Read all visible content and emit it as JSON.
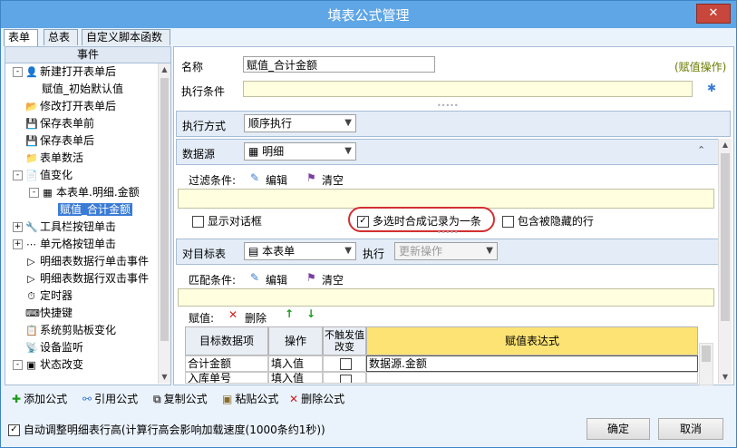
{
  "window": {
    "title": "填表公式管理",
    "close": "✕"
  },
  "tabs": [
    "表单",
    "总表",
    "自定义脚本函数"
  ],
  "left": {
    "header": "事件",
    "tree": [
      {
        "label": "新建打开表单后",
        "indent": 0,
        "exp": "-",
        "icon": "👤"
      },
      {
        "label": "赋值_初始默认值",
        "indent": 1,
        "exp": "",
        "icon": ""
      },
      {
        "label": "修改打开表单后",
        "indent": 0,
        "exp": "",
        "icon": "📂"
      },
      {
        "label": "保存表单前",
        "indent": 0,
        "exp": "",
        "icon": "💾"
      },
      {
        "label": "保存表单后",
        "indent": 0,
        "exp": "",
        "icon": "💾"
      },
      {
        "label": "表单数活",
        "indent": 0,
        "exp": "",
        "icon": "📁"
      },
      {
        "label": "值变化",
        "indent": 0,
        "exp": "-",
        "icon": "📄"
      },
      {
        "label": "本表单.明细.金额",
        "indent": 1,
        "exp": "-",
        "icon": "▦"
      },
      {
        "label": "赋值_合计金额",
        "indent": 2,
        "exp": "",
        "icon": "",
        "sel": true
      },
      {
        "label": "工具栏按钮单击",
        "indent": 0,
        "exp": "+",
        "icon": "🔧"
      },
      {
        "label": "单元格按钮单击",
        "indent": 0,
        "exp": "+",
        "icon": "⋯"
      },
      {
        "label": "明细表数据行单击事件",
        "indent": 0,
        "exp": "",
        "icon": "▷"
      },
      {
        "label": "明细表数据行双击事件",
        "indent": 0,
        "exp": "",
        "icon": "▷"
      },
      {
        "label": "定时器",
        "indent": 0,
        "exp": "",
        "icon": "⏱"
      },
      {
        "label": "快捷键",
        "indent": 0,
        "exp": "",
        "icon": "⌨"
      },
      {
        "label": "系统剪贴板变化",
        "indent": 0,
        "exp": "",
        "icon": "📋"
      },
      {
        "label": "设备监听",
        "indent": 0,
        "exp": "",
        "icon": "📡"
      },
      {
        "label": "状态改变",
        "indent": 0,
        "exp": "-",
        "icon": "▣"
      },
      {
        "label": "...",
        "indent": 1,
        "exp": "",
        "icon": ""
      }
    ]
  },
  "right": {
    "name_label": "名称",
    "name_value": "赋值_合计金额",
    "op_type": "(赋值操作)",
    "cond_label": "执行条件",
    "cond_value": "",
    "exec_label": "执行方式",
    "exec_value": "顺序执行",
    "source_label": "数据源",
    "source_value": "明细",
    "filter_label": "过滤条件:",
    "edit": "编辑",
    "clear": "清空",
    "show_dialog": "显示对话框",
    "multi_merge": "多选时合成记录为一条",
    "include_hidden": "包含被隐藏的行",
    "target_label": "对目标表",
    "target_value": "本表单",
    "exec2_label": "执行",
    "exec2_value": "更新操作",
    "match_label": "匹配条件:",
    "assign_label": "赋值:",
    "delete": "删除",
    "grid_headers": [
      "目标数据项",
      "操作",
      "不触发值改变",
      "赋值表达式"
    ],
    "grid_rows": [
      [
        "合计金额",
        "填入值",
        "",
        "数据源.金额"
      ],
      [
        "入库单号",
        "填入值",
        "",
        ""
      ]
    ]
  },
  "toolbar": {
    "add": "添加公式",
    "ref": "引用公式",
    "copy": "复制公式",
    "paste": "粘贴公式",
    "del": "删除公式"
  },
  "footer": {
    "auto_adjust": "自动调整明细表行高(计算行高会影响加载速度(1000条约1秒))",
    "ok": "确定",
    "cancel": "取消"
  }
}
